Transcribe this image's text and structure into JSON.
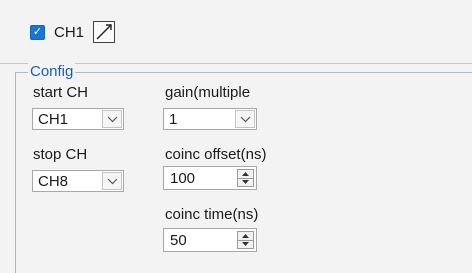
{
  "channel": {
    "label": "CH1",
    "checked": true
  },
  "config": {
    "title": "Config",
    "start_ch": {
      "label": "start CH",
      "value": "CH1"
    },
    "stop_ch": {
      "label": "stop CH",
      "value": "CH8"
    },
    "gain": {
      "label": "gain(multiple",
      "value": "1"
    },
    "coinc_offset": {
      "label": "coinc offset(ns)",
      "value": "100"
    },
    "coinc_time": {
      "label": "coinc time(ns)",
      "value": "50"
    }
  },
  "colors": {
    "accent": "#1976d2",
    "group_title": "#1a5fb4"
  },
  "icons": {
    "chart_button": "line-chart-icon",
    "dropdown": "chevron-down-icon",
    "spin": "spin-arrows-icon"
  }
}
